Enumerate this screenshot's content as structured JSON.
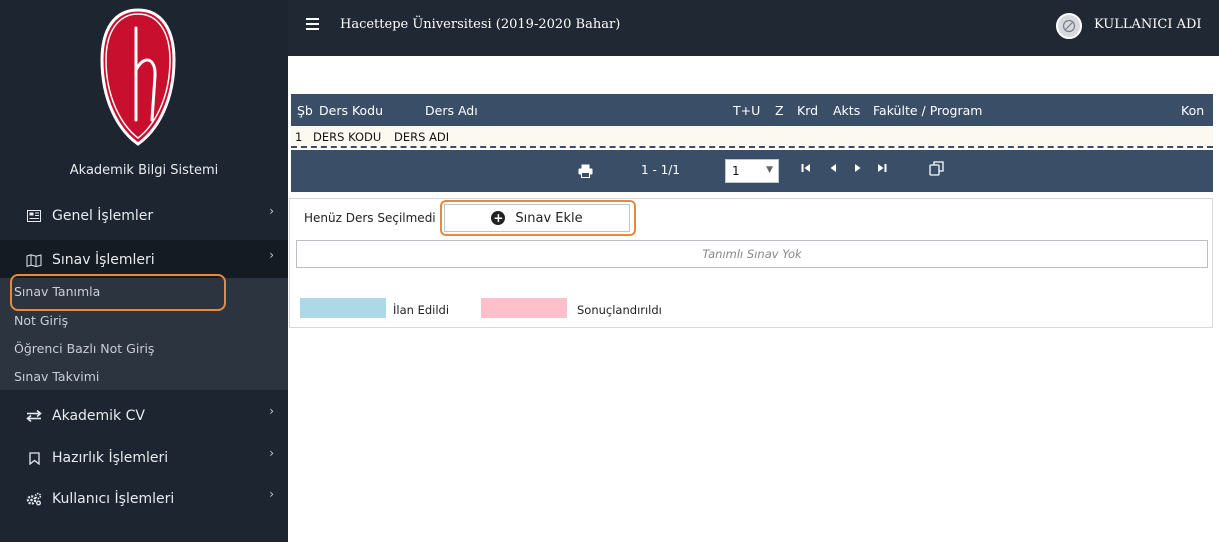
{
  "app": {
    "name": "Akademik Bilgi Sistemi",
    "title": "Hacettepe Üniversitesi (2019-2020 Bahar)",
    "user_name": "KULLANICI ADI",
    "brand_color": "#c8102e"
  },
  "sidebar": {
    "menu": [
      {
        "label": "Genel İşlemler",
        "icon": "newspaper-icon"
      },
      {
        "label": "Sınav İşlemleri",
        "icon": "map-icon",
        "expanded": true
      },
      {
        "label": "Akademik CV",
        "icon": "exchange-icon"
      },
      {
        "label": "Hazırlık İşlemleri",
        "icon": "bookmark-icon"
      },
      {
        "label": "Kullanıcı İşlemleri",
        "icon": "cogs-icon"
      }
    ],
    "submenu": [
      {
        "label": "Sınav Tanımla",
        "selected": true
      },
      {
        "label": "Not Giriş"
      },
      {
        "label": "Öğrenci Bazlı Not Giriş"
      },
      {
        "label": "Sınav Takvimi"
      }
    ]
  },
  "course_table": {
    "columns": [
      "Şb",
      "Ders Kodu",
      "Ders Adı",
      "T+U",
      "Z",
      "Krd",
      "Akts",
      "Fakülte / Program",
      "Kon"
    ],
    "rows": [
      {
        "sb": "1",
        "code": "DERS KODU",
        "name": "DERS ADI"
      }
    ],
    "pager": {
      "range": "1 - 1/1",
      "page": "1"
    }
  },
  "exam_panel": {
    "status": "Henüz Ders Seçilmedi",
    "add_button": "Sınav Ekle",
    "empty_text": "Tanımlı Sınav Yok",
    "legend": [
      {
        "label": "İlan Edildi",
        "color": "#add8e6"
      },
      {
        "label": "Sonuçlandırıldı",
        "color": "#ffc0cb"
      }
    ]
  }
}
